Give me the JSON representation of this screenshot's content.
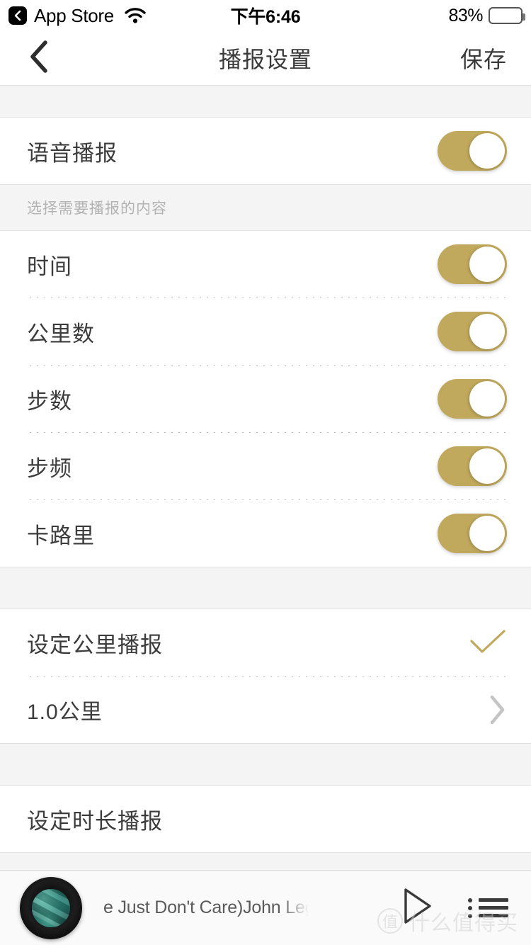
{
  "status_bar": {
    "back_app_label": "App Store",
    "back_icon": "chevron-left-badge-icon",
    "wifi_icon": "wifi-icon",
    "time": "下午6:46",
    "battery_percent_label": "83%",
    "battery_level": 83,
    "battery_icon": "battery-icon"
  },
  "nav_bar": {
    "back_icon": "chevron-left-icon",
    "title": "播报设置",
    "save_label": "保存"
  },
  "master": {
    "label": "语音播报",
    "toggle_on": true
  },
  "content_section": {
    "header": "选择需要播报的内容",
    "items": [
      {
        "label": "时间",
        "toggle_on": true
      },
      {
        "label": "公里数",
        "toggle_on": true
      },
      {
        "label": "步数",
        "toggle_on": true
      },
      {
        "label": "步频",
        "toggle_on": true
      },
      {
        "label": "卡路里",
        "toggle_on": true
      }
    ]
  },
  "distance_section": {
    "title": "设定公里播报",
    "check_icon": "checkmark-icon",
    "value_label": "1.0公里",
    "chevron_icon": "chevron-right-icon"
  },
  "duration_section": {
    "title": "设定时长播报"
  },
  "music_bar": {
    "album_art": "vinyl-record-album-art",
    "track_text": "e Just Don't Care)John Legend – P.D.A. (",
    "play_icon": "play-icon",
    "playlist_icon": "playlist-icon"
  },
  "watermark": {
    "logo": "值",
    "text": "什么值得买"
  },
  "colors": {
    "toggle_on": "#c0a85c",
    "checkmark": "#c0a85c",
    "chevron": "#c4c4c4",
    "section_bg": "#f4f4f4",
    "text_primary": "#3c3c3c",
    "text_muted": "#b3b3b3"
  }
}
